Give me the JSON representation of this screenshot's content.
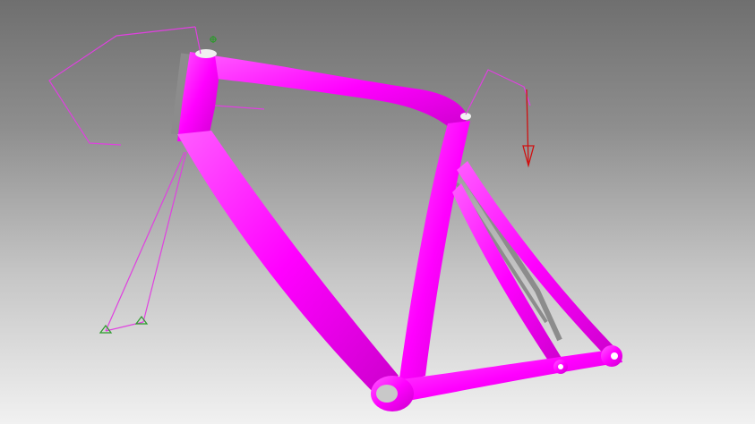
{
  "viewport": {
    "background_top": "#6f6f6f",
    "background_bottom": "#f1f1f1"
  },
  "model": {
    "type": "bicycle-frame",
    "color": "#ff00ff",
    "highlight_color": "#ff66ff",
    "shadow_color": "#c000c0",
    "edge_color": "#8a8a8a"
  },
  "overlays": {
    "load_path_color": "#e040e0",
    "force_arrow_color": "#d01010",
    "support_marker_color": "#2a9a2a",
    "axis_indicator_color": "#2a9a2a"
  }
}
